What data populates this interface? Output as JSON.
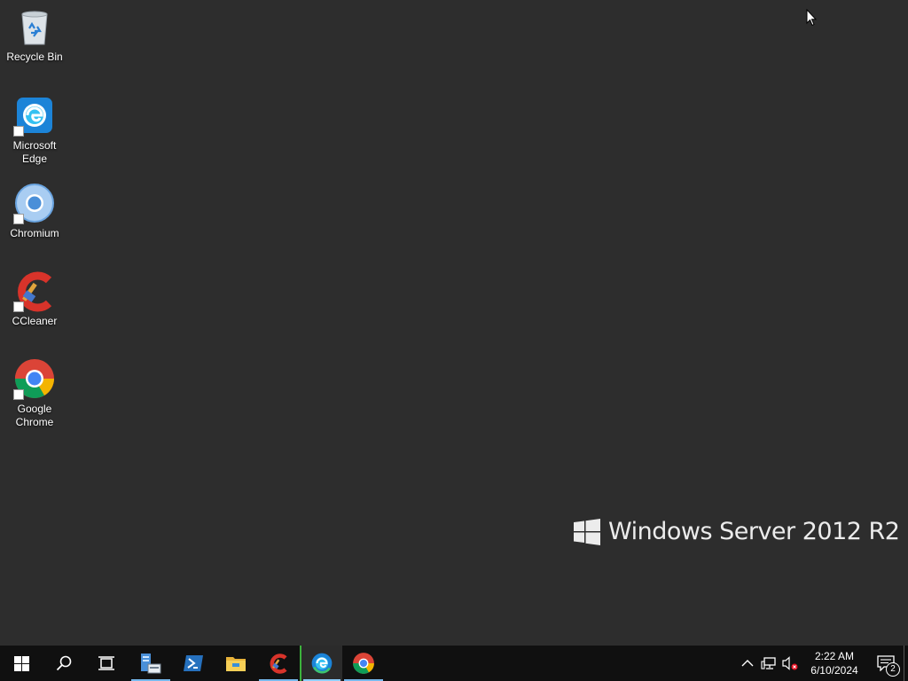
{
  "desktop": {
    "icons": [
      {
        "label": "Recycle Bin"
      },
      {
        "label": "Microsoft\nEdge"
      },
      {
        "label": "Chromium"
      },
      {
        "label": "CCleaner"
      },
      {
        "label": "Google\nChrome"
      }
    ],
    "watermark": "Windows Server 2012 R2"
  },
  "taskbar": {
    "clock_time": "2:22 AM",
    "clock_date": "6/10/2024",
    "notification_count": "2"
  },
  "colors": {
    "desktop_bg": "#2d2d2d",
    "taskbar_bg": "#101010",
    "running_indicator": "#76b9ed"
  }
}
